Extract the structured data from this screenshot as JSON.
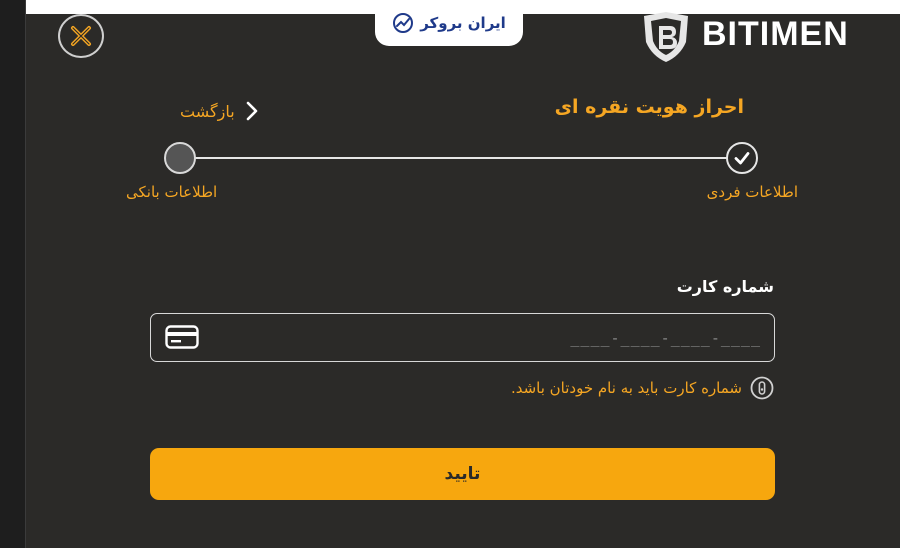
{
  "watermark": {
    "text": "ایران بروکر"
  },
  "brand": {
    "name": "BITIMEN"
  },
  "header": {
    "title": "احراز هویت نقره ای",
    "back_label": "بازگشت"
  },
  "stepper": {
    "steps": [
      {
        "label": "اطلاعات فردی",
        "status": "done"
      },
      {
        "label": "اطلاعات بانکی",
        "status": "pending"
      }
    ]
  },
  "form": {
    "card_label": "شماره کارت",
    "card_value": "",
    "card_placeholder": "____-____-____-____",
    "hint": "شماره کارت باید به نام خودتان باشد.",
    "submit_label": "تایید"
  },
  "colors": {
    "accent": "#f5a623",
    "button": "#f7a70e",
    "panel": "#2b2a28",
    "watermark": "#1f3a8a"
  }
}
